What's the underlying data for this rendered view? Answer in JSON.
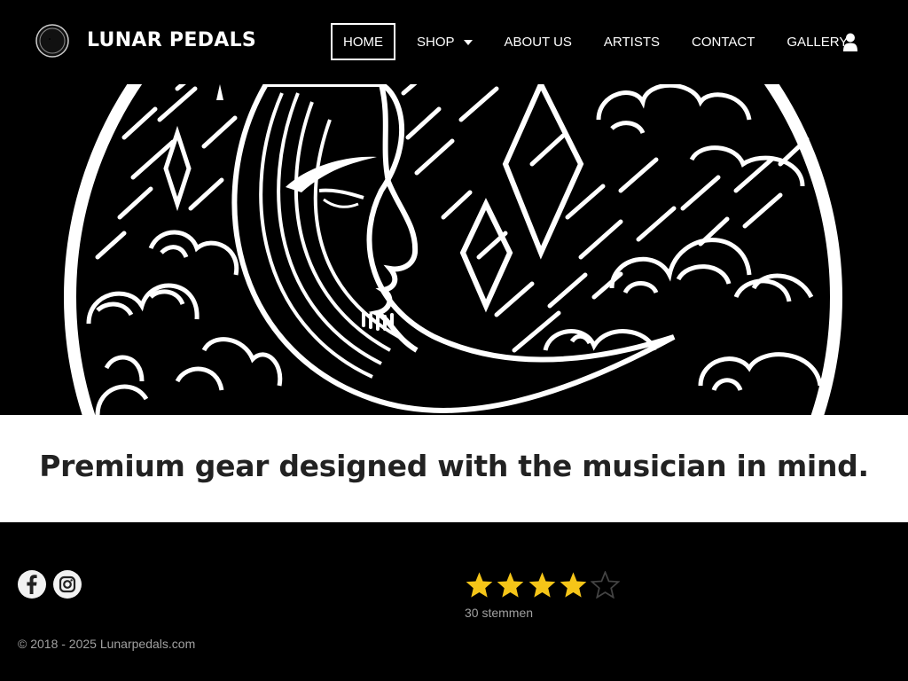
{
  "brand": {
    "name": "LUNAR PEDALS",
    "logo_icon": "moon-logo-icon"
  },
  "nav": {
    "items": [
      {
        "label": "HOME",
        "active": true
      },
      {
        "label": "SHOP",
        "dropdown": true
      },
      {
        "label": "ABOUT US"
      },
      {
        "label": "ARTISTS"
      },
      {
        "label": "CONTACT"
      },
      {
        "label": "GALLERY"
      }
    ],
    "user_icon": "user-icon"
  },
  "hero": {
    "image": "crescent-moon-illustration"
  },
  "tagline": "Premium gear designed with the musician in mind.",
  "footer": {
    "social": [
      {
        "icon": "facebook-icon"
      },
      {
        "icon": "instagram-icon"
      }
    ],
    "copyright": "© 2018 - 2025 Lunarpedals.com",
    "rating": {
      "value": 4,
      "max": 5,
      "votes_label": "30 stemmen"
    }
  },
  "colors": {
    "background": "#000000",
    "star_filled": "#f5c518",
    "star_empty": "#444444",
    "band": "#ffffff",
    "tagline_text": "#222222"
  }
}
